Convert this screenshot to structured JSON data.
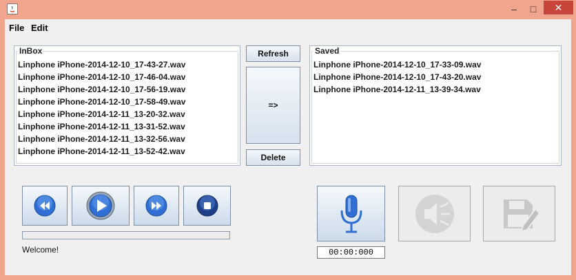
{
  "menu": {
    "file": "File",
    "edit": "Edit"
  },
  "window_controls": {
    "minimize": "–",
    "maximize": "□",
    "close": "✕"
  },
  "inbox": {
    "title": "InBox",
    "items": [
      "Linphone iPhone-2014-12-10_17-43-27.wav",
      "Linphone iPhone-2014-12-10_17-46-04.wav",
      "Linphone iPhone-2014-12-10_17-56-19.wav",
      "Linphone iPhone-2014-12-10_17-58-49.wav",
      "Linphone iPhone-2014-12-11_13-20-32.wav",
      "Linphone iPhone-2014-12-11_13-31-52.wav",
      "Linphone iPhone-2014-12-11_13-32-56.wav",
      "Linphone iPhone-2014-12-11_13-52-42.wav"
    ]
  },
  "saved": {
    "title": "Saved",
    "items": [
      "Linphone iPhone-2014-12-10_17-33-09.wav",
      "Linphone iPhone-2014-12-10_17-43-20.wav",
      "Linphone iPhone-2014-12-11_13-39-34.wav"
    ]
  },
  "buttons": {
    "refresh": "Refresh",
    "move": "=>",
    "delete": "Delete"
  },
  "player": {
    "rewind_icon": "rewind-icon",
    "play_icon": "play-icon",
    "forward_icon": "fast-forward-icon",
    "stop_icon": "stop-icon",
    "progress": 0
  },
  "status": "Welcome!",
  "recorder": {
    "mic_icon": "microphone-icon",
    "speaker_icon": "speaker-icon",
    "save_icon": "save-edit-icon",
    "timer": "00:00:000"
  },
  "colors": {
    "titlebar": "#f0a58c",
    "close": "#c7453a",
    "accent_blue": "#2f6fd3"
  }
}
